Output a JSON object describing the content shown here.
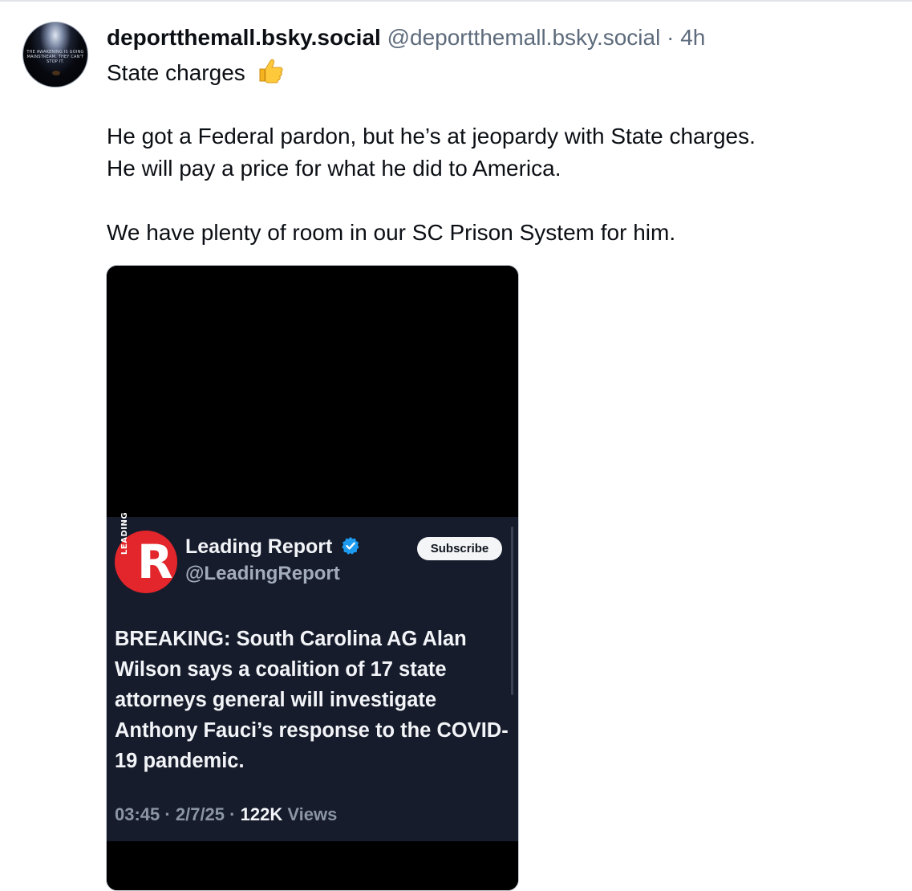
{
  "post": {
    "display_name": "deportthemall.bsky.social",
    "handle": "@deportthemall.bsky.social",
    "separator": "·",
    "time": "4h",
    "avatar_text": "THE AWAKENING IS GOING MAINSTREAM. THEY CAN'T STOP IT.",
    "text_line1": "State charges",
    "text_line1_emoji": "thumbs-up-icon",
    "text_line2": "He got a Federal pardon, but he’s at jeopardy with State charges.",
    "text_line3": "He will pay a price for what he did to America.",
    "text_line4": "We have plenty of room in our SC Prison System for him."
  },
  "embedded_tweet": {
    "logo_letter": "R",
    "logo_side_text": "LEADING",
    "name": "Leading Report",
    "verified_icon": "verified-badge-icon",
    "handle": "@LeadingReport",
    "subscribe_label": "Subscribe",
    "body": "BREAKING: South Carolina AG Alan Wilson says a coalition of 17 state attorneys general will investigate Anthony Fauci’s response to the COVID-19 pandemic.",
    "time": "03:45",
    "date": "2/7/25",
    "dot": "·",
    "views_count": "122K",
    "views_label": "Views"
  },
  "colors": {
    "text": "#0b0f14",
    "muted": "#5d6b7c",
    "card_bg": "#161c2b",
    "brand_red": "#e3262b",
    "verified_blue": "#1d9bf0"
  }
}
